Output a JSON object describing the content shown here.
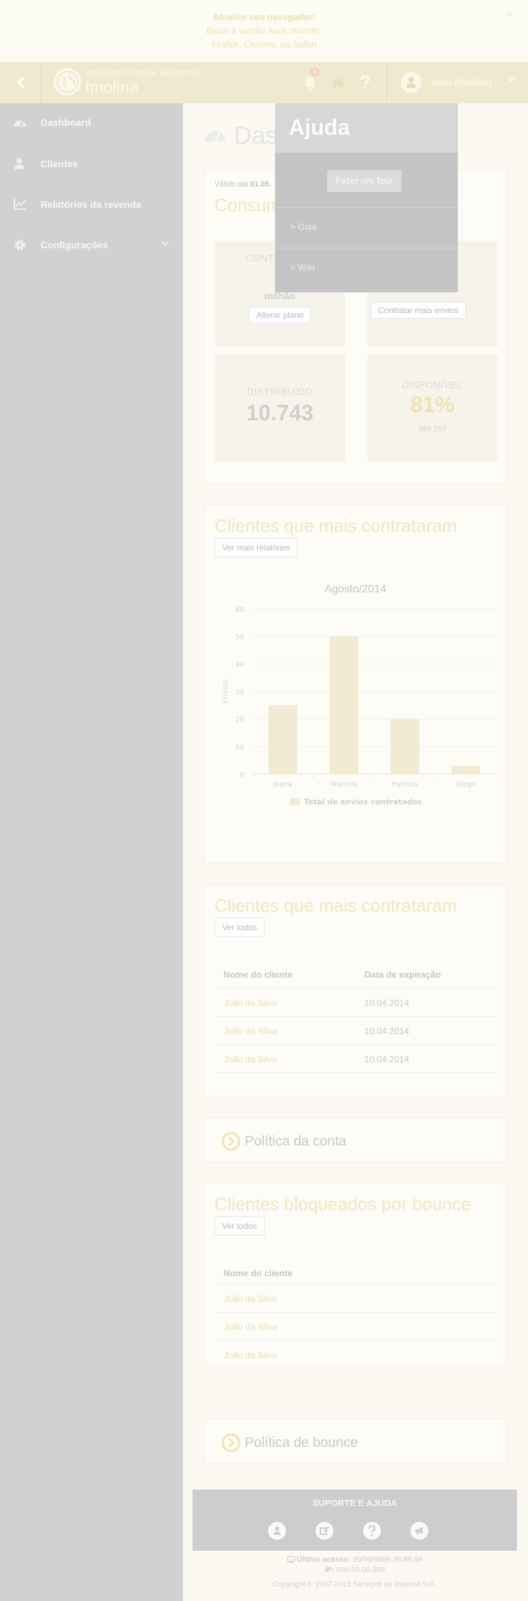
{
  "banner": {
    "title": "Atualize seu navegador!",
    "line1": "Baixe a versão mais recente:",
    "line2": "Firefox, Chrome, ou Safari",
    "close": "×"
  },
  "header": {
    "logo_subtitle": "REVENDA DO EMAIL MARKETING",
    "logo_name": "fmolina",
    "notification_count": "0",
    "user_name": "João (fmolina)"
  },
  "sidebar": {
    "items": [
      {
        "label": "Dashboard",
        "icon": "dashboard-icon"
      },
      {
        "label": "Clientes",
        "icon": "clients-icon"
      },
      {
        "label": "Relatórios da revenda",
        "icon": "chart-line-icon"
      },
      {
        "label": "Configurações",
        "icon": "gear-icon"
      }
    ]
  },
  "main": {
    "page_title": "Das",
    "valid_label": "Válido até",
    "valid_date": "01.05.",
    "consumo_title": "Consum",
    "stats": {
      "contracted_label": "CONT",
      "contracted_value": "milhão",
      "change_plan_button": "Alterar plano",
      "hire_more_button": "Contratar mais envios",
      "distributed_label": "DISTRIBUÍDO",
      "distributed_value": "10.743",
      "available_label": "DISPONÍVEL",
      "available_pct": "81%",
      "available_value": "989.257"
    },
    "top_clients_chart": {
      "title": "Clientes que mais contrataram",
      "button": "Ver mais relatórios"
    },
    "top_clients_table": {
      "title": "Clientes que mais contrataram",
      "button": "Ver todos",
      "columns": [
        "Nome do cliente",
        "Data de expiração"
      ],
      "rows": [
        [
          "João da Silva",
          "10.04.2014"
        ],
        [
          "João da Silva",
          "10.04.2014"
        ],
        [
          "João da Silva",
          "10.04.2014"
        ]
      ]
    },
    "account_policy": "Política da conta",
    "bounce_blocked": {
      "title": "Clientes bloqueados por bounce",
      "button": "Ver todos",
      "column": "Nome do cliente",
      "rows": [
        "João da Silva",
        "João da Silva",
        "João da Silva"
      ]
    },
    "bounce_policy": "Política de bounce"
  },
  "chart_data": {
    "type": "bar",
    "title": "Agosto/2014",
    "categories": [
      "Joana",
      "Marcela",
      "Patricia",
      "Diego"
    ],
    "series": [
      {
        "name": "Total de envios contratados",
        "values": [
          25,
          50,
          20,
          3
        ]
      }
    ],
    "ylabel": "Envios",
    "xlabel": "",
    "ylim": [
      0,
      60
    ],
    "yticks": [
      0,
      10,
      20,
      30,
      40,
      50,
      60
    ],
    "grid": true,
    "legend": "bottom",
    "bar_color": "#f0ebd2"
  },
  "footer": {
    "support_title": "SUPORTE E AJUDA",
    "last_access_label": "Último acesso:",
    "last_access_value": "99/99/9999 99:99:99",
    "ip_label": "IP:",
    "ip_value": "000.00.00.000",
    "copyright": "Copyright © 1997-2015 Serviços de Internet S/A."
  },
  "help_menu": {
    "title": "Ajuda",
    "tour_button": "Fazer um Tour",
    "links": [
      "> Guia",
      "> Wiki"
    ]
  },
  "colors": {
    "accent": "#efe6c2",
    "sidebar": "#d1d1d1",
    "header": "#efeacf",
    "dropdown": "#c4c4c4"
  }
}
